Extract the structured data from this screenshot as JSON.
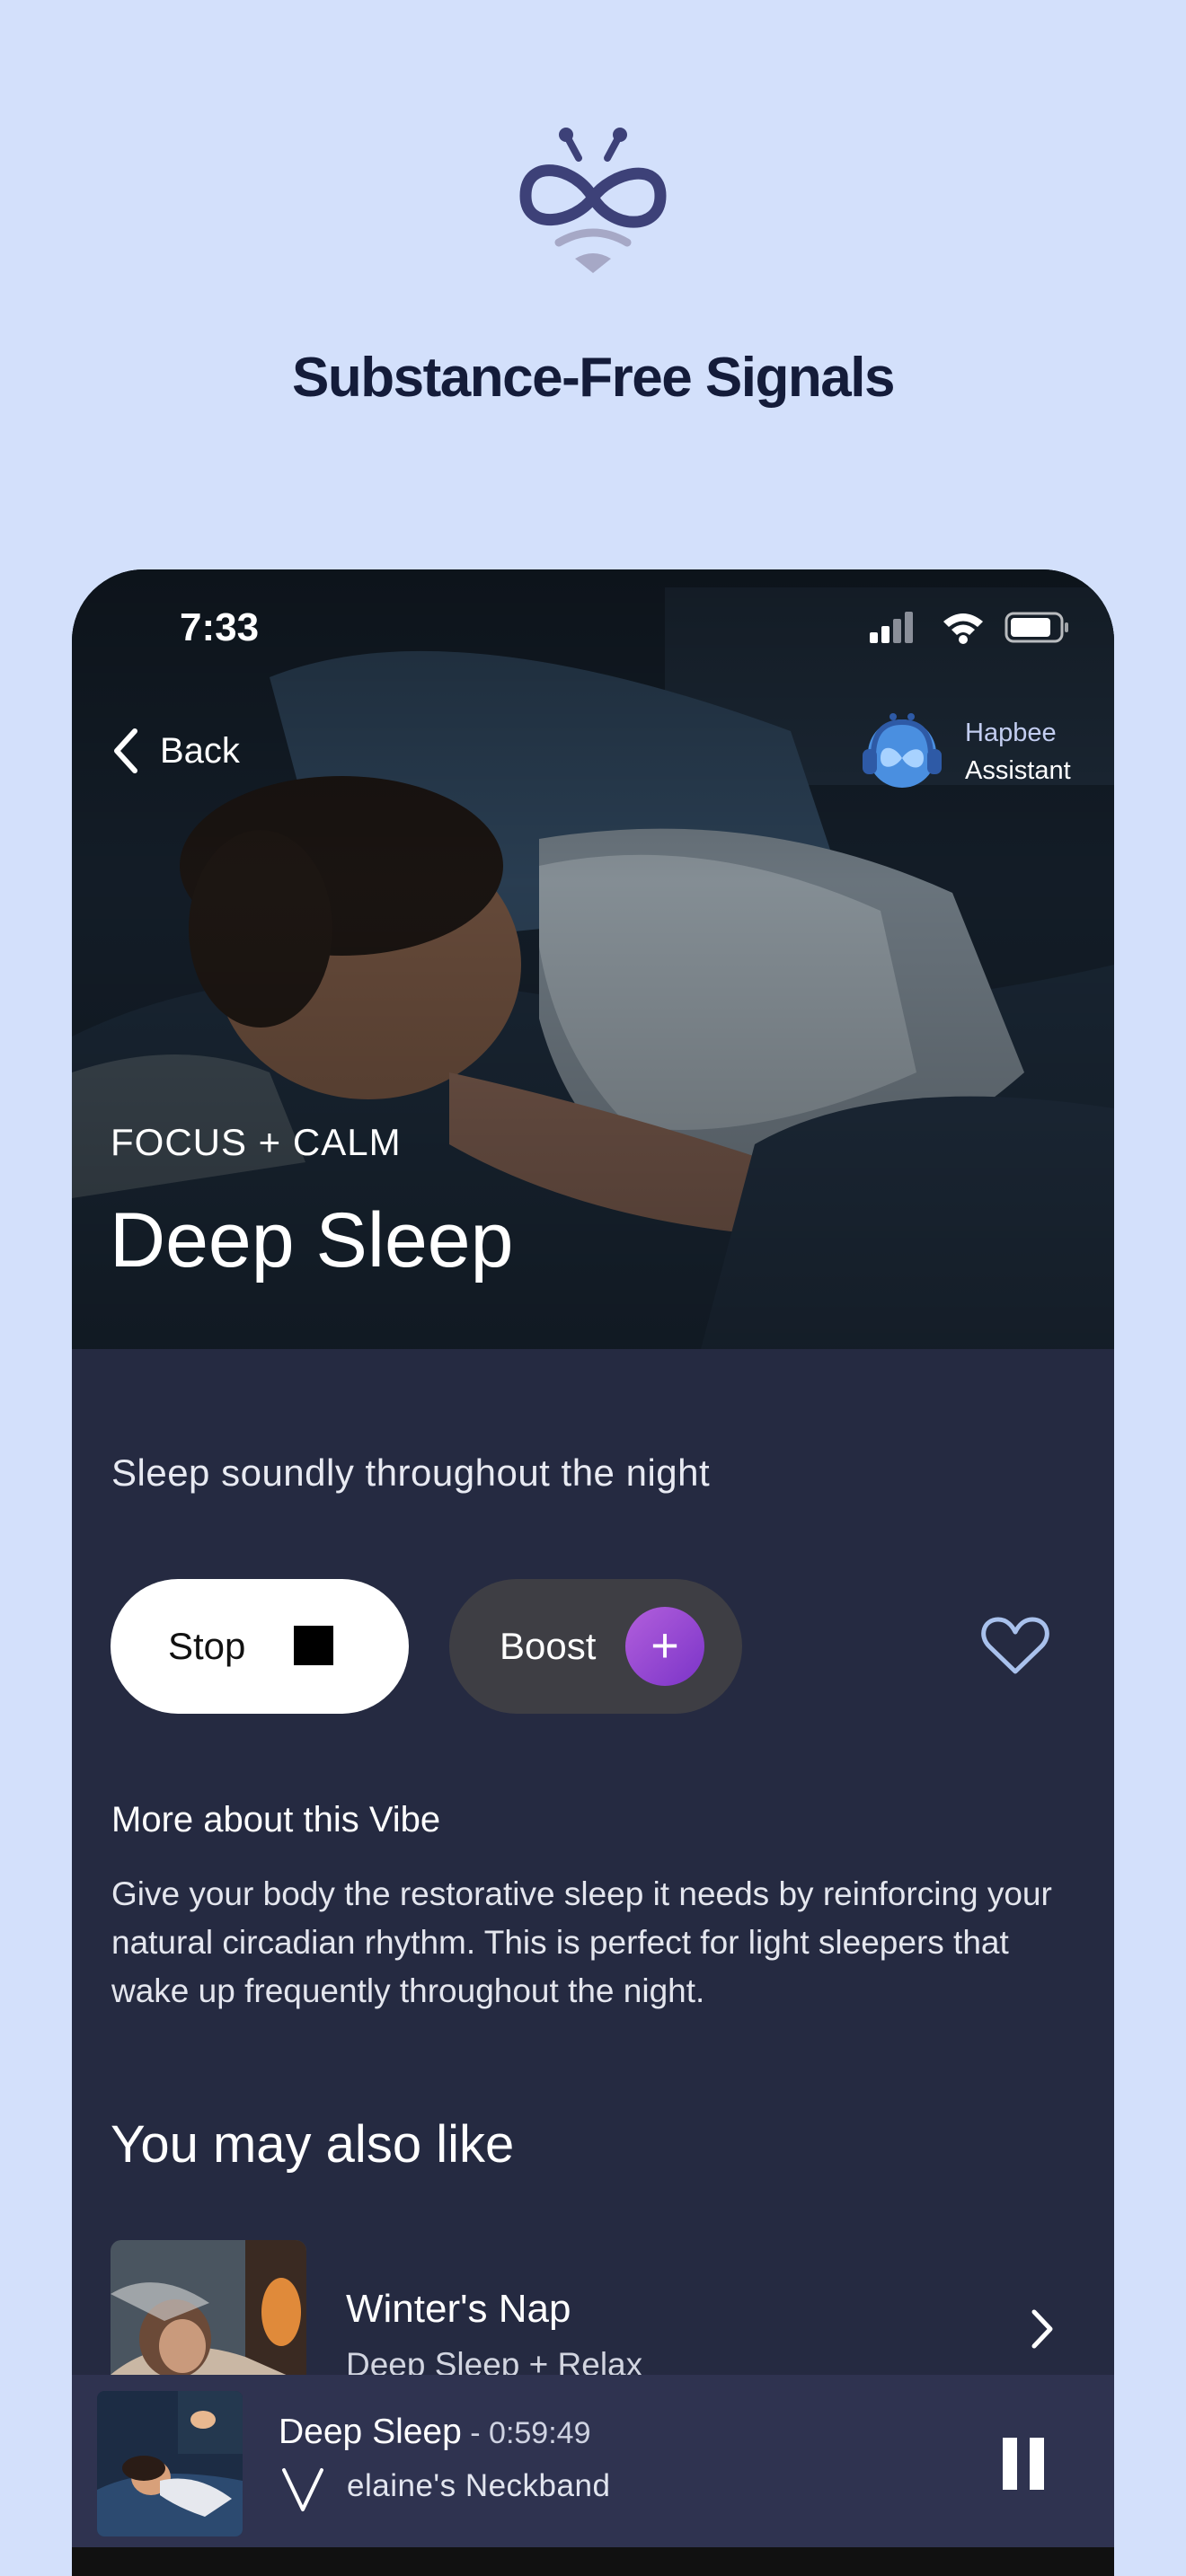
{
  "page": {
    "headline": "Substance-Free Signals"
  },
  "status_bar": {
    "time": "7:33"
  },
  "nav": {
    "back_label": "Back",
    "assistant_line1": "Hapbee",
    "assistant_line2": "Assistant"
  },
  "vibe": {
    "category": "FOCUS + CALM",
    "title": "Deep Sleep",
    "subtitle": "Sleep soundly throughout the night",
    "stop_label": "Stop",
    "boost_label": "Boost",
    "boost_icon": "+",
    "more_title": "More about this Vibe",
    "more_body": "Give your body the restorative sleep it needs by reinforcing your natural circadian rhythm. This is perfect for light sleepers that wake up frequently throughout the night."
  },
  "recommendations": {
    "title": "You may also like",
    "items": [
      {
        "title": "Winter's Nap",
        "subtitle": "Deep Sleep + Relax"
      }
    ]
  },
  "now_playing": {
    "title": "Deep Sleep",
    "separator": " - ",
    "time_remaining": "0:59:49",
    "device": "elaine's Neckband"
  },
  "colors": {
    "background": "#d3e0fb",
    "headline": "#141c3a",
    "panel": "#252a41",
    "mini_player": "#2f3350",
    "boost_accent": "#9b4ad6",
    "logo": "#3d4178"
  },
  "icons": [
    "hapbee-logo-icon",
    "signal-icon",
    "wifi-icon",
    "battery-icon",
    "chevron-left-icon",
    "assistant-avatar-icon",
    "stop-square-icon",
    "plus-icon",
    "heart-icon",
    "chevron-right-icon",
    "neckband-icon",
    "pause-icon"
  ]
}
